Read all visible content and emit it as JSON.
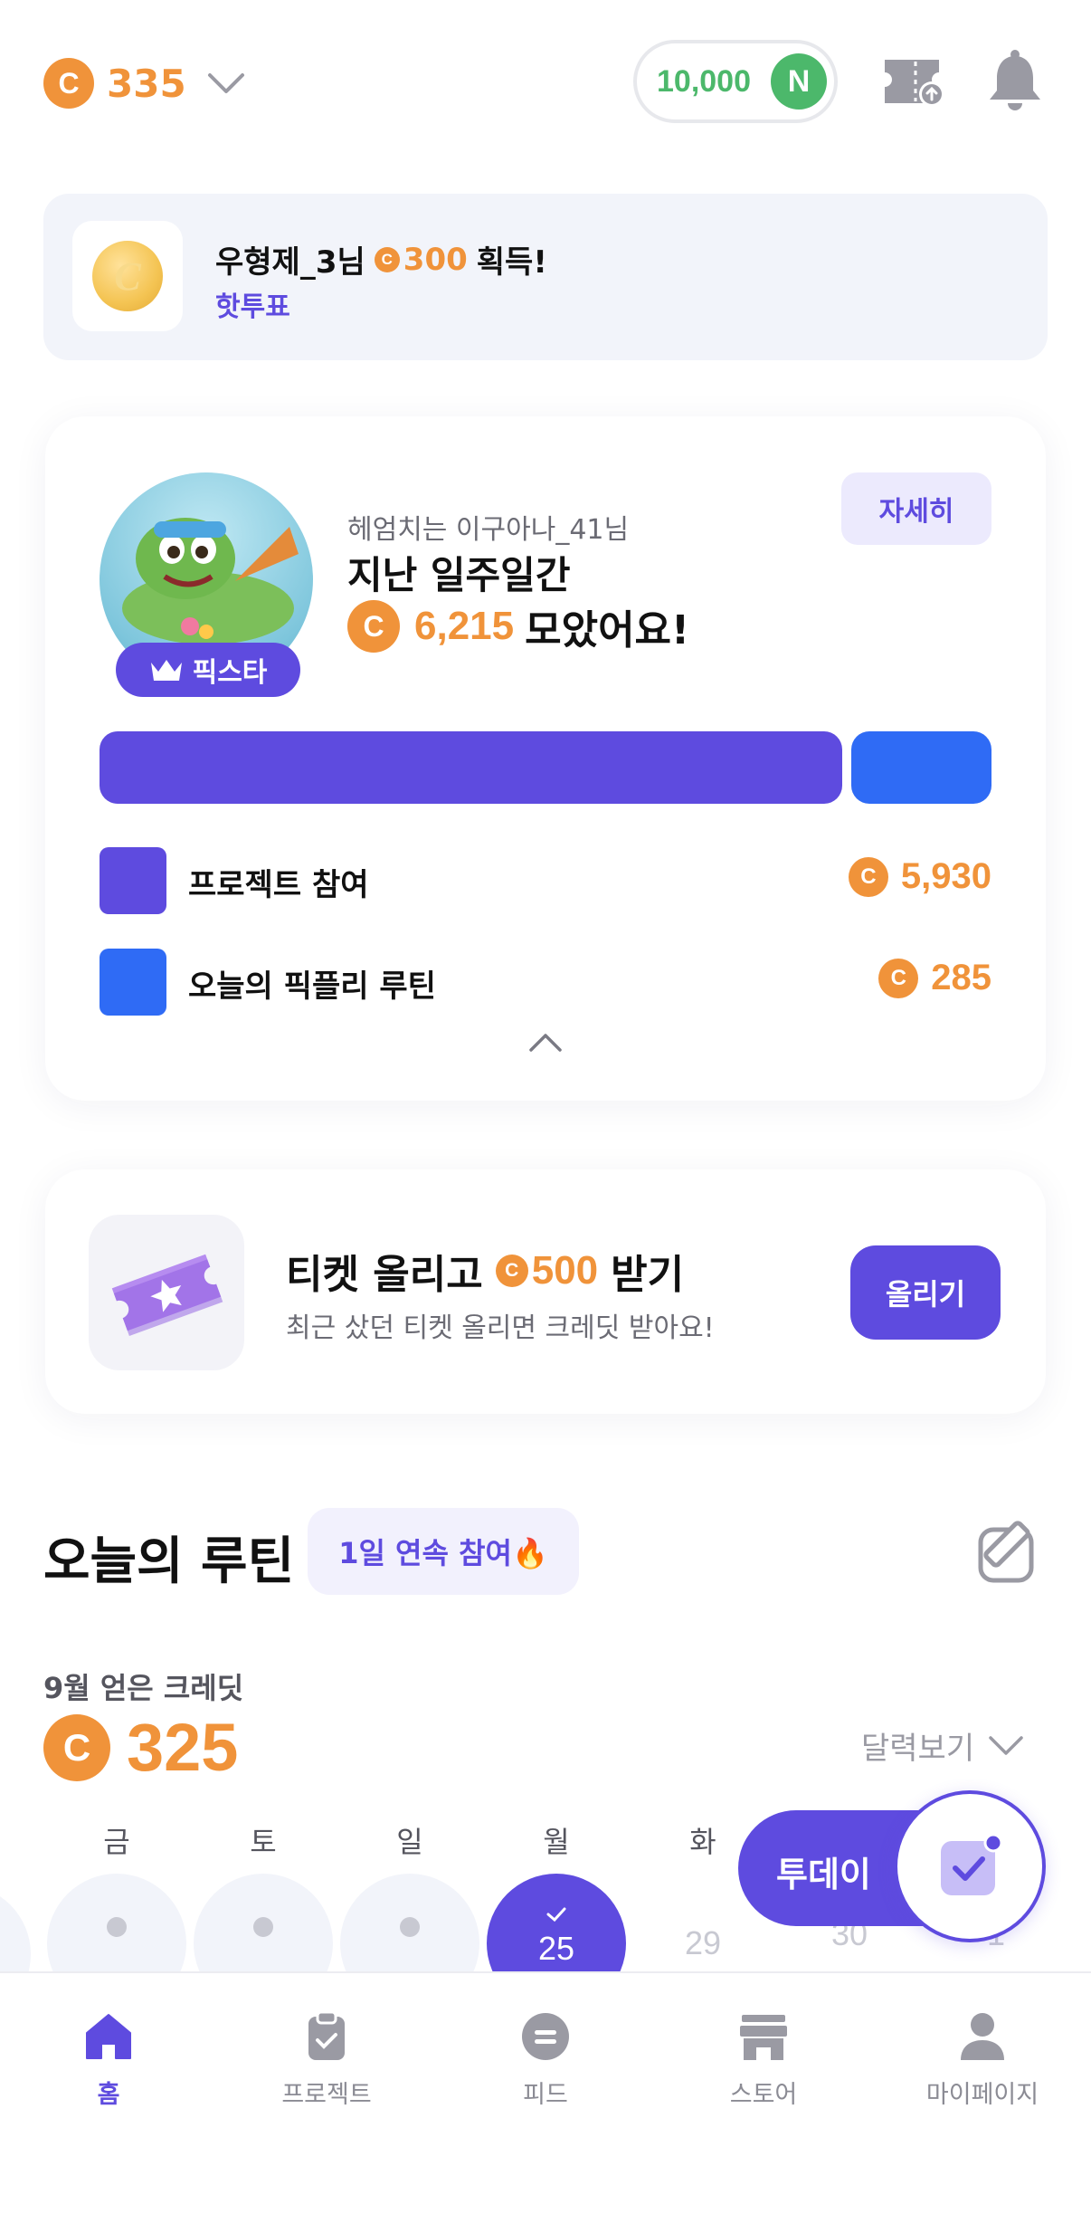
{
  "colors": {
    "accent": "#5E4BDF",
    "secondary": "#2F6BF5",
    "coin": "#F0933A",
    "green": "#4CB86B",
    "light_bg": "#F2F4FA"
  },
  "header": {
    "coin_symbol": "C",
    "balance": "335",
    "n_points": "10,000",
    "n_badge": "N",
    "icons": [
      "chevron-down-icon",
      "ticket-upload-icon",
      "bell-icon"
    ]
  },
  "notice": {
    "user": "우형제_3님",
    "coin_symbol": "C",
    "amount": "300",
    "suffix": "획득!",
    "source": "핫투표"
  },
  "weekly": {
    "avatar_badge": "픽스타",
    "username": "헤엄치는 이구아나_41님",
    "line1": "지난 일주일간",
    "coin_symbol": "C",
    "total": "6,215",
    "suffix": "모았어요!",
    "detail_button": "자세히",
    "breakdown": [
      {
        "label": "프로젝트 참여",
        "value": "5,930",
        "amount": 5930,
        "color": "#5E4BDF"
      },
      {
        "label": "오늘의 픽플리 루틴",
        "value": "285",
        "amount": 285,
        "color": "#2F6BF5"
      }
    ]
  },
  "ticket": {
    "title_prefix": "티켓 올리고",
    "coin_symbol": "C",
    "amount": "500",
    "title_suffix": "받기",
    "subtitle": "최근 샀던 티켓 올리면 크레딧 받아요!",
    "button": "올리기"
  },
  "routine": {
    "title": "오늘의 루틴",
    "streak_badge": "1일 연속 참여🔥",
    "month_label": "9월 얻은 크레딧",
    "coin_symbol": "C",
    "month_total": "325",
    "calendar_toggle": "달력보기",
    "days": [
      {
        "weekday": "금",
        "date": ""
      },
      {
        "weekday": "토",
        "date": ""
      },
      {
        "weekday": "일",
        "date": ""
      },
      {
        "weekday": "월",
        "date": "25"
      },
      {
        "weekday": "화",
        "date": "29"
      },
      {
        "weekday": "",
        "date": "30"
      },
      {
        "weekday": "",
        "date": "1"
      }
    ],
    "fab_label": "투데이"
  },
  "tabbar": {
    "items": [
      {
        "label": "홈",
        "icon": "home-icon"
      },
      {
        "label": "프로젝트",
        "icon": "clipboard-icon"
      },
      {
        "label": "피드",
        "icon": "feed-icon"
      },
      {
        "label": "스토어",
        "icon": "store-icon"
      },
      {
        "label": "마이페이지",
        "icon": "person-icon"
      }
    ]
  }
}
